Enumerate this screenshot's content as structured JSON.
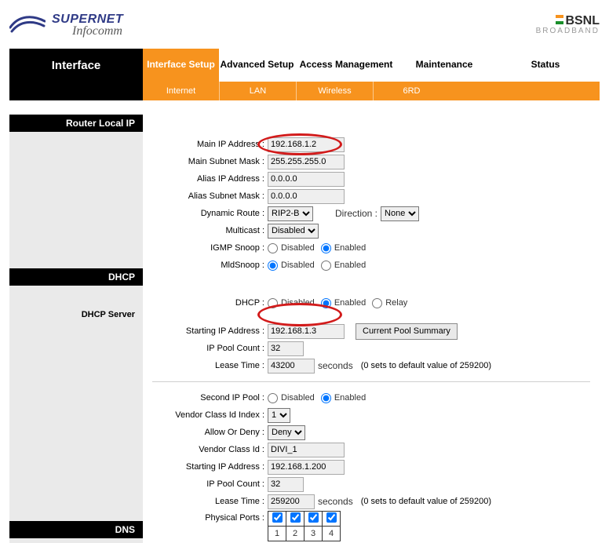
{
  "brand": {
    "logo_top": "SUPERNET",
    "logo_bottom": "Infocomm",
    "isp_top": "BSNL",
    "isp_bottom": "BROADBAND"
  },
  "nav": {
    "title": "Interface",
    "tabs": [
      "Interface Setup",
      "Advanced Setup",
      "Access Management",
      "Maintenance",
      "Status"
    ],
    "active": 0,
    "subtabs": [
      "Internet",
      "LAN",
      "Wireless",
      "6RD"
    ]
  },
  "sections": {
    "router_local_ip": "Router Local IP",
    "dhcp": "DHCP",
    "dhcp_server": "DHCP Server",
    "dns": "DNS"
  },
  "labels": {
    "main_ip": "Main IP Address :",
    "main_mask": "Main Subnet Mask :",
    "alias_ip": "Alias IP Address :",
    "alias_mask": "Alias Subnet Mask :",
    "dyn_route": "Dynamic Route :",
    "direction": "Direction :",
    "multicast": "Multicast :",
    "igmp": "IGMP Snoop :",
    "mld": "MldSnoop :",
    "dhcp": "DHCP :",
    "start_ip": "Starting IP Address :",
    "pool": "IP Pool Count :",
    "lease": "Lease Time :",
    "seconds": "seconds",
    "lease_note": "(0 sets to default value of 259200)",
    "second_pool": "Second IP Pool :",
    "vclass_idx": "Vendor Class Id Index :",
    "allow_deny": "Allow Or Deny :",
    "vclass_id": "Vendor Class Id :",
    "phys_ports": "Physical Ports :",
    "current_pool": "Current Pool Summary",
    "disabled": "Disabled",
    "enabled": "Enabled",
    "relay": "Relay"
  },
  "values": {
    "main_ip": "192.168.1.2",
    "main_mask": "255.255.255.0",
    "alias_ip": "0.0.0.0",
    "alias_mask": "0.0.0.0",
    "dyn_route": "RIP2-B",
    "direction": "None",
    "multicast": "Disabled",
    "igmp": "enabled",
    "mld": "disabled",
    "dhcp_mode": "enabled",
    "start_ip": "192.168.1.3",
    "pool": "32",
    "lease": "43200",
    "second_pool": "enabled",
    "vclass_idx": "1",
    "allow_deny": "Deny",
    "vclass_id": "DIVI_1",
    "start_ip2": "192.168.1.200",
    "pool2": "32",
    "lease2": "259200",
    "ports": [
      true,
      true,
      true,
      true
    ],
    "port_nums": [
      "1",
      "2",
      "3",
      "4"
    ]
  }
}
